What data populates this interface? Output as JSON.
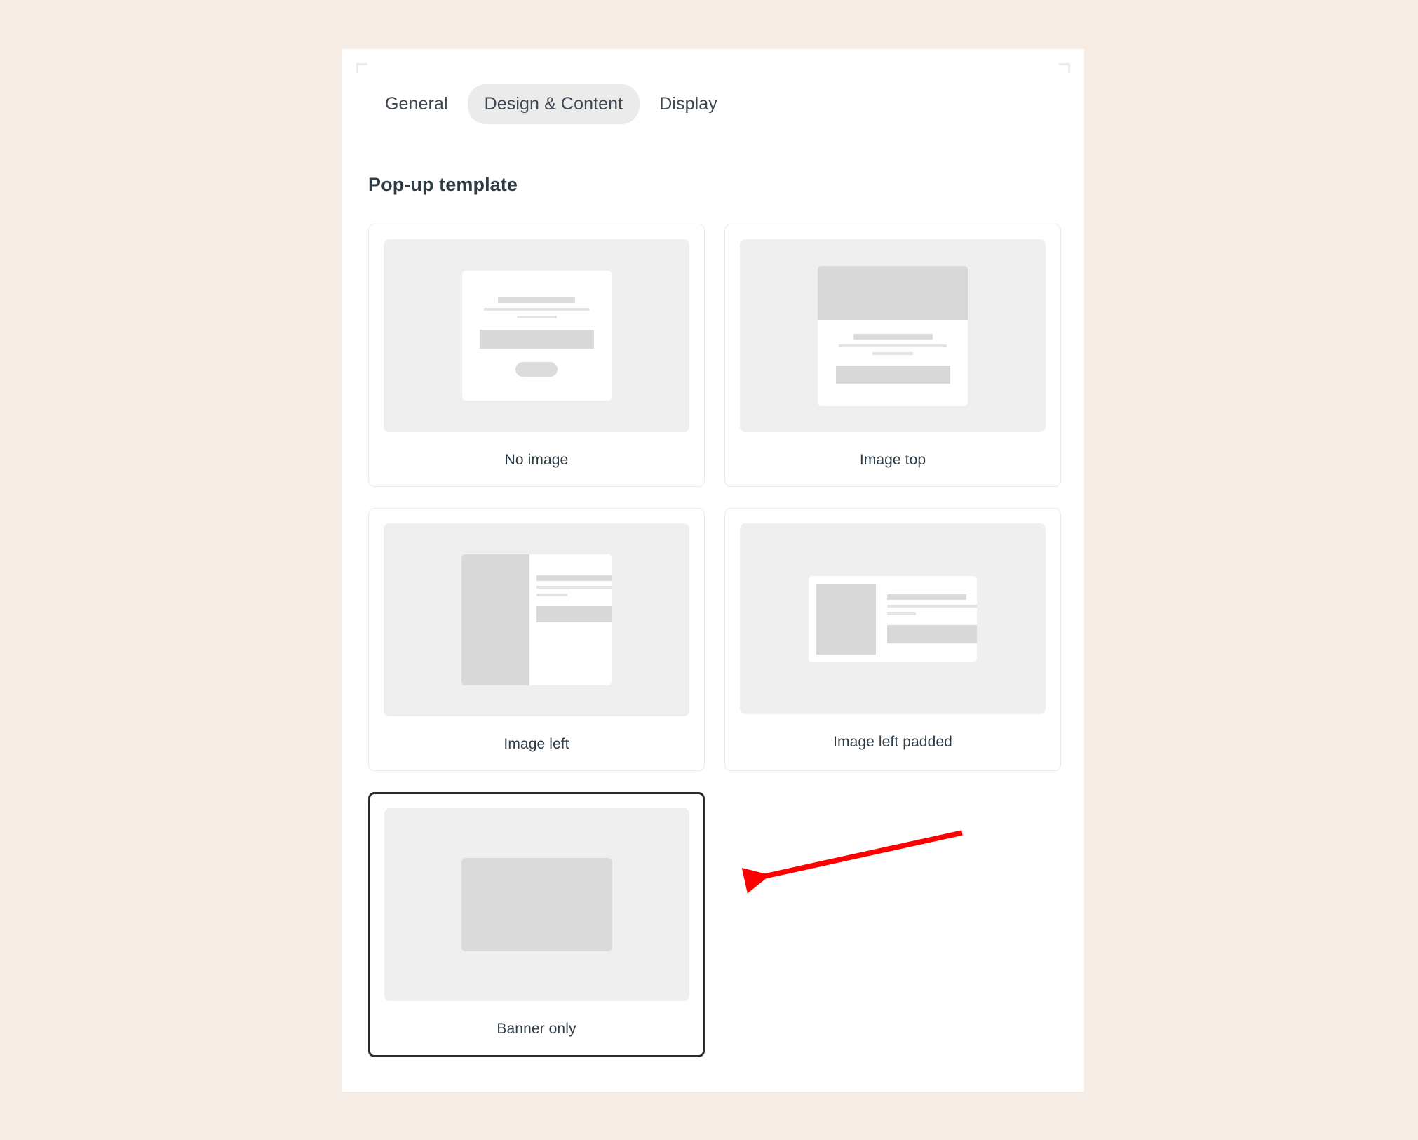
{
  "background_color": "#f5ece6",
  "panel": {
    "background_color": "#ffffff"
  },
  "tabs": {
    "items": [
      {
        "label": "General",
        "active": false
      },
      {
        "label": "Design & Content",
        "active": true
      },
      {
        "label": "Display",
        "active": false
      }
    ],
    "active_tab_background": "#ebebeb",
    "text_color": "#3d4852"
  },
  "section": {
    "title": "Pop-up template",
    "title_color": "#2d3b45"
  },
  "templates": {
    "selected": "Banner only",
    "selected_border_color": "#2b2b2b",
    "card_border_color": "#eaeaea",
    "thumb_background": "#efefef",
    "placeholder_color": "#d9d9d9",
    "items": [
      {
        "label": "No image",
        "variant": "no-image",
        "selected": false
      },
      {
        "label": "Image top",
        "variant": "img-top",
        "selected": false
      },
      {
        "label": "Image left",
        "variant": "img-left",
        "selected": false
      },
      {
        "label": "Image left padded",
        "variant": "img-left-pad",
        "selected": false
      },
      {
        "label": "Banner only",
        "variant": "banner-only",
        "selected": true
      }
    ]
  },
  "annotation": {
    "type": "arrow",
    "color": "#ff0000",
    "points_to": "Banner only",
    "direction": "left-down"
  }
}
